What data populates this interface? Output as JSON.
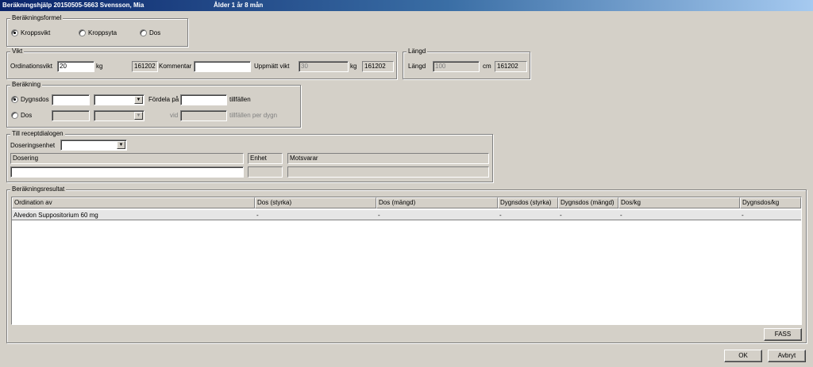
{
  "window": {
    "title": "Beräkningshjälp  20150505-5663 Svensson, Mia",
    "age": "Ålder 1 år 8 mån"
  },
  "formel": {
    "legend": "Beräkningsformel",
    "options": [
      {
        "label": "Kroppsvikt",
        "selected": true
      },
      {
        "label": "Kroppsyta",
        "selected": false
      },
      {
        "label": "Dos",
        "selected": false
      }
    ]
  },
  "vikt": {
    "legend": "Vikt",
    "ordinationsvikt_label": "Ordinationsvikt",
    "ordinationsvikt_value": "20",
    "unit_kg": "kg",
    "date": "161202",
    "kommentar_label": "Kommentar",
    "kommentar_value": "",
    "uppmatt_label": "Uppmätt vikt",
    "uppmatt_value": "30",
    "uppmatt_unit": "kg",
    "uppmatt_date": "161202"
  },
  "langd": {
    "legend": "Längd",
    "label": "Längd",
    "value": "100",
    "unit": "cm",
    "date": "161202"
  },
  "berakning": {
    "legend": "Beräkning",
    "dygnsdos_label": "Dygnsdos",
    "dygnsdos_selected": true,
    "dygnsdos_value": "",
    "dygnsdos_unit": "",
    "fordela_label": "Fördela på",
    "fordela_value": "",
    "tillfallen_label": "tillfällen",
    "dos_label": "Dos",
    "dos_selected": false,
    "dos_value": "",
    "dos_unit": "",
    "vid_label": "vid",
    "vid_value": "",
    "tillfallen_per_dygn_label": "tillfällen per dygn"
  },
  "receptdialog": {
    "legend": "Till receptdialogen",
    "doseringsenhet_label": "Doseringsenhet",
    "doseringsenhet_value": "",
    "dosering_label": "Dosering",
    "dosering_value": "",
    "enhet_label": "Enhet",
    "enhet_value": "",
    "motsvarar_label": "Motsvarar",
    "motsvarar_value": ""
  },
  "resultat": {
    "legend": "Beräkningsresultat",
    "columns": [
      "Ordination av",
      "Dos (styrka)",
      "Dos (mängd)",
      "Dygnsdos (styrka)",
      "Dygnsdos (mängd)",
      "Dos/kg",
      "Dygnsdos/kg"
    ],
    "rows": [
      [
        "Alvedon Suppositorium 60 mg",
        "-",
        "-",
        "-",
        "-",
        "-",
        "-"
      ]
    ],
    "fass_button": "FASS"
  },
  "buttons": {
    "ok": "OK",
    "cancel": "Avbryt"
  }
}
